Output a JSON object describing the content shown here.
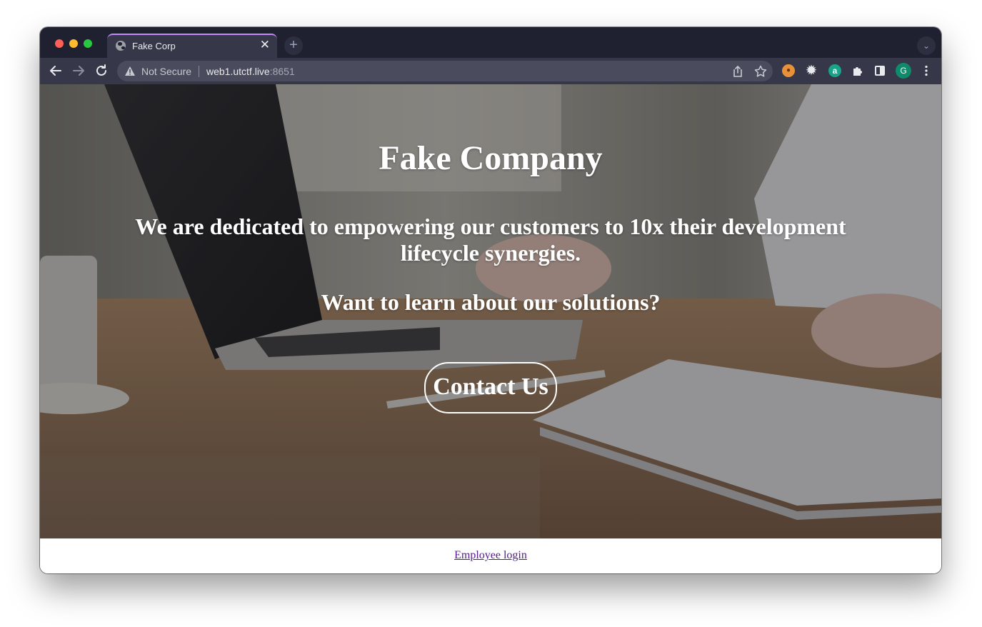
{
  "browser": {
    "tab_title": "Fake Corp",
    "tab_close_glyph": "✕",
    "new_tab_glyph": "+",
    "tab_search_glyph": "⌄",
    "security_label": "Not Secure",
    "url_host": "web1.utctf.live",
    "url_port": ":8651",
    "toolbar_icons": [
      "back-arrow-icon",
      "forward-arrow-icon",
      "reload-icon",
      "warning-icon",
      "share-icon",
      "star-icon",
      "cookie-extension-icon",
      "gear-extension-icon",
      "amazon-extension-icon",
      "puzzle-extensions-icon",
      "side-panel-icon",
      "profile-avatar",
      "kebab-menu-icon"
    ],
    "profile_initial": "G",
    "amazon_letter": "a",
    "accent_color": "#c58af9"
  },
  "page": {
    "title": "Fake Company",
    "tagline": "We are dedicated to empowering our customers to 10x their development lifecycle synergies.",
    "question": "Want to learn about our solutions?",
    "contact_button": "Contact Us",
    "footer_link": "Employee login",
    "link_color": "#551a8b"
  }
}
